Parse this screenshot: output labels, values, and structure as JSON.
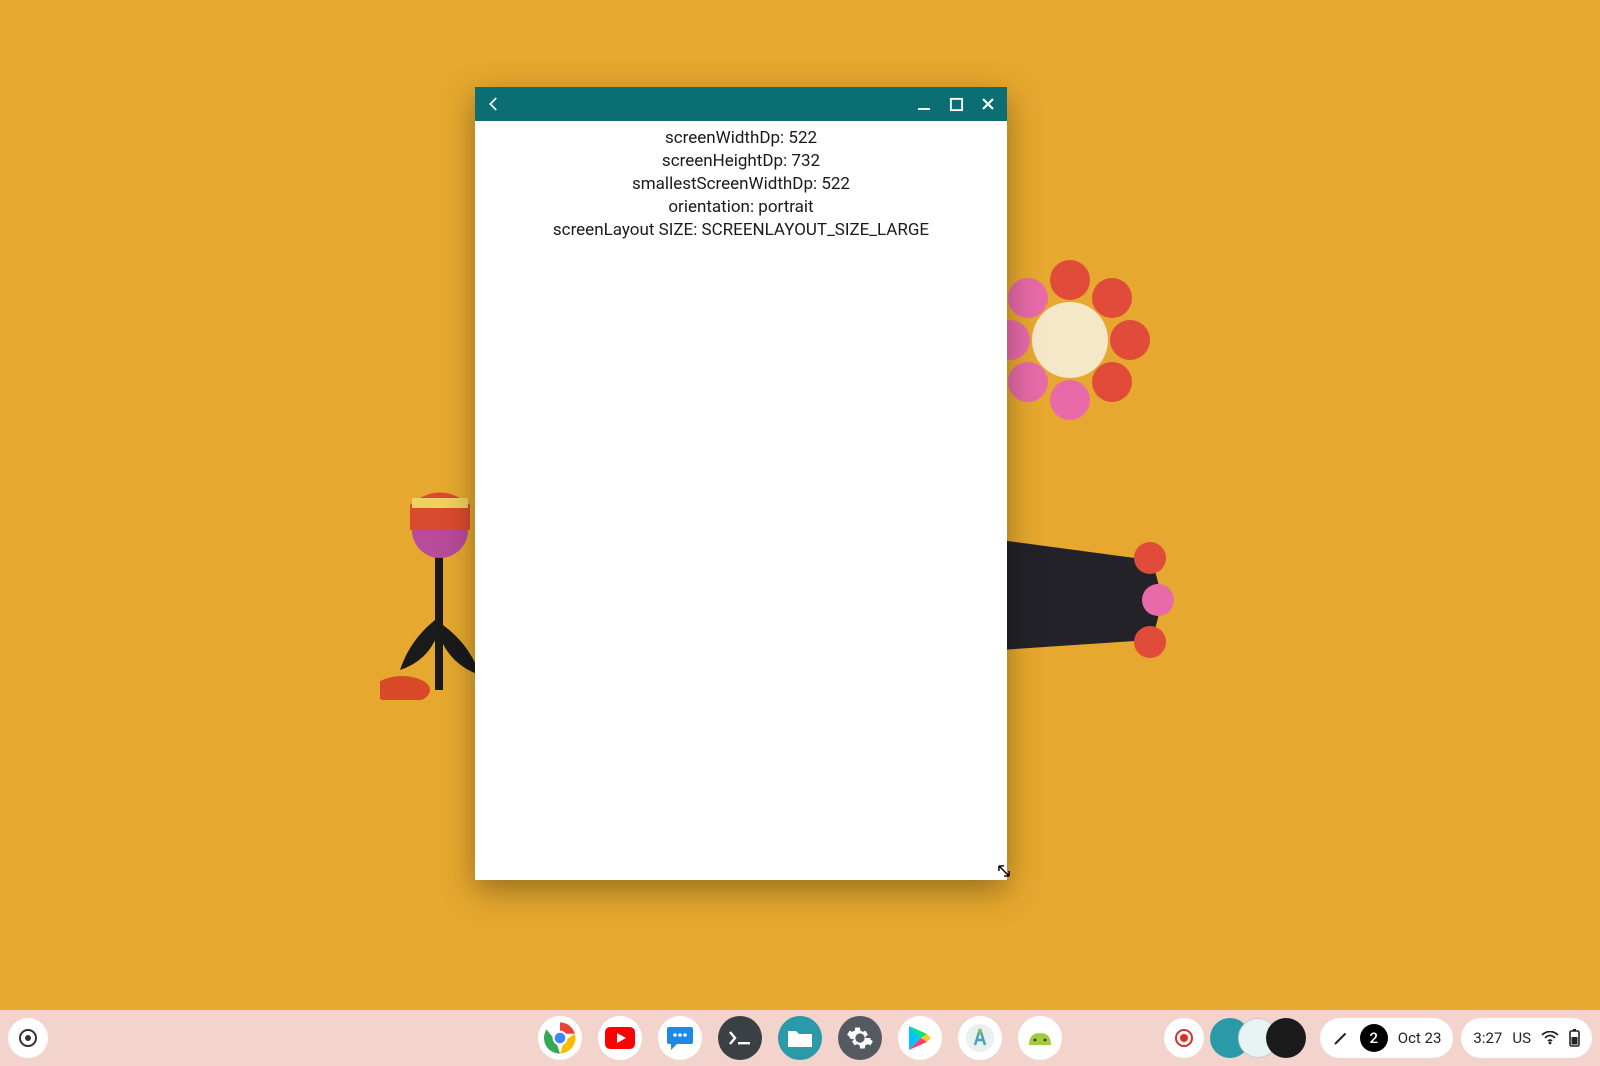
{
  "app_window": {
    "lines": [
      "screenWidthDp: 522",
      "screenHeightDp: 732",
      "smallestScreenWidthDp: 522",
      "orientation: portrait",
      "screenLayout SIZE: SCREENLAYOUT_SIZE_LARGE"
    ]
  },
  "shelf": {
    "apps": [
      "Chrome",
      "YouTube",
      "Messages",
      "Terminal",
      "Files",
      "Settings",
      "Play Store",
      "Android Studio",
      "Emulator"
    ]
  },
  "status": {
    "notification_count": "2",
    "date": "Oct 23",
    "time": "3:27",
    "locale": "US"
  }
}
